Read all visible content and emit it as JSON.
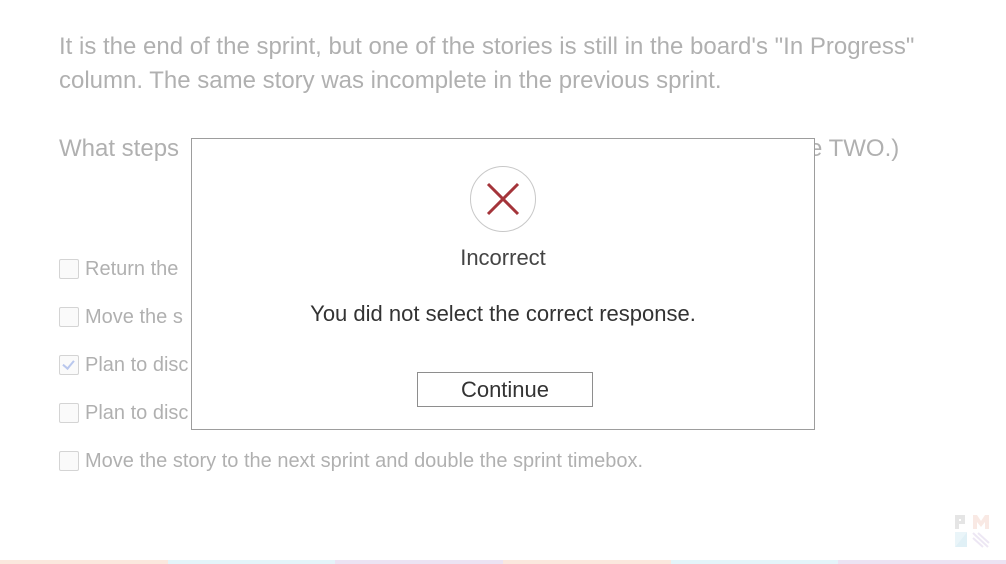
{
  "question": {
    "text": "It is the end of the sprint, but one of the stories is still in the board's \"In Progress\" column. The same story was incomplete in the previous sprint.",
    "prompt_visible_left": "What steps",
    "prompt_visible_right": "se TWO.)",
    "options": [
      {
        "label": "Return the",
        "checked": false
      },
      {
        "label": "Move the s",
        "checked": false
      },
      {
        "label": "Plan to disc",
        "checked": true
      },
      {
        "label": "Plan to disc",
        "checked": false
      },
      {
        "label": "Move the story to the next sprint and double the sprint timebox.",
        "checked": false
      }
    ]
  },
  "modal": {
    "icon": "x-circle-icon",
    "icon_color": "#a4343a",
    "title": "Incorrect",
    "message": "You did not select the correct response.",
    "continue_label": "Continue"
  },
  "branding": {
    "logo_text": "PM",
    "bottom_bar_colors": [
      "#f6c9b1",
      "#bfe6f2",
      "#d3bde3",
      "#f6c9b1",
      "#bfe6f2",
      "#d3bde3"
    ]
  }
}
